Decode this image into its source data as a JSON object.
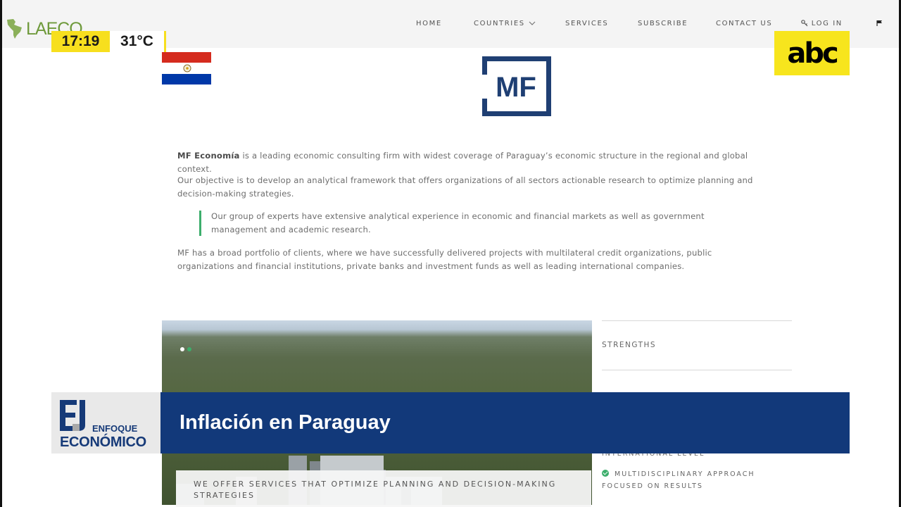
{
  "website": {
    "logo_text": "LAECO",
    "nav": [
      {
        "label": "HOME",
        "icon": null
      },
      {
        "label": "COUNTRIES",
        "icon": "chevron-down-icon"
      },
      {
        "label": "SERVICES",
        "icon": null
      },
      {
        "label": "SUBSCRIBE",
        "icon": null
      },
      {
        "label": "CONTACT US",
        "icon": null
      },
      {
        "label": "LOG IN",
        "icon": "key-icon"
      }
    ],
    "flag_icon": "flag-icon",
    "brand_logo_text": "MF",
    "intro_strong": "MF Economía",
    "intro_rest": " is a leading economic consulting firm with widest coverage of Paraguay’s economic structure in the regional and global context.",
    "objective": "Our objective is to develop an analytical framework that offers organizations of all sectors actionable research to optimize planning and decision-making strategies.",
    "quote": "Our group of experts have extensive analytical experience in economic and financial markets as well as government management and academic research.",
    "portfolio": "MF has a broad portfolio of clients, where we have successfully delivered projects with multilateral credit organizations, public organizations and financial institutions, private banks and investment funds as well as leading international companies.",
    "services_caption": "WE OFFER SERVICES THAT OPTIMIZE PLANNING AND DECISION-MAKING STRATEGIES",
    "strengths_title": "STRENGTHS",
    "strength_partial": "INTERNATIONAL LEVEL",
    "strength_item_1": "MULTIDISCIPLINARY APPROACH",
    "strength_item_1b": "FOCUSED ON RESULTS",
    "colors": {
      "accent_green": "#3dae6c",
      "logo_navy": "#1f3f73",
      "logo_gray": "#6d6e70"
    }
  },
  "tv_overlay": {
    "time": "17:19",
    "temperature": "31°C",
    "channel_logo": "abc",
    "program_line1": "ENFOQUE",
    "program_line2": "ECONÓMICO",
    "headline": "Inflación en Paraguay",
    "colors": {
      "yellow": "#f7df1e",
      "navy": "#12397a"
    }
  }
}
